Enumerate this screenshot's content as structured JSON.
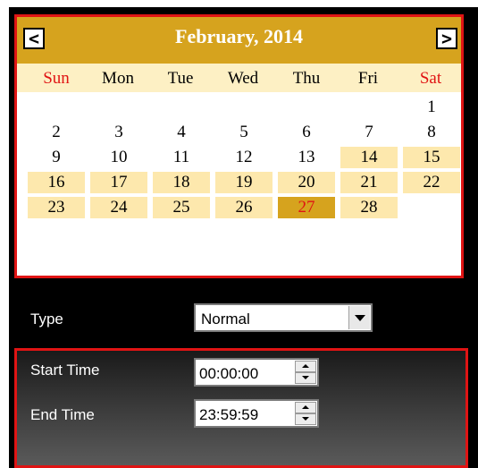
{
  "calendar": {
    "title": "February, 2014",
    "prev_label": "<",
    "next_label": ">",
    "weekdays": [
      "Sun",
      "Mon",
      "Tue",
      "Wed",
      "Thu",
      "Fri",
      "Sat"
    ],
    "days": [
      "1",
      "2",
      "3",
      "4",
      "5",
      "6",
      "7",
      "8",
      "9",
      "10",
      "11",
      "12",
      "13",
      "14",
      "15",
      "16",
      "17",
      "18",
      "19",
      "20",
      "21",
      "22",
      "23",
      "24",
      "25",
      "26",
      "27",
      "28"
    ],
    "highlighted_days": [
      "14",
      "15",
      "16",
      "17",
      "18",
      "19",
      "20",
      "21",
      "22",
      "23",
      "24",
      "25",
      "26",
      "28"
    ],
    "selected_day": "27",
    "colors": {
      "header": "#d6a31e",
      "weekday_row": "#fdf0c4",
      "highlight": "#fde8ad",
      "weekend_text": "#e01414",
      "border": "#e01414"
    }
  },
  "type_row": {
    "label": "Type",
    "value": "Normal"
  },
  "time_panel": {
    "start_label": "Start Time",
    "start_value": "00:00:00",
    "end_label": "End Time",
    "end_value": "23:59:59"
  }
}
